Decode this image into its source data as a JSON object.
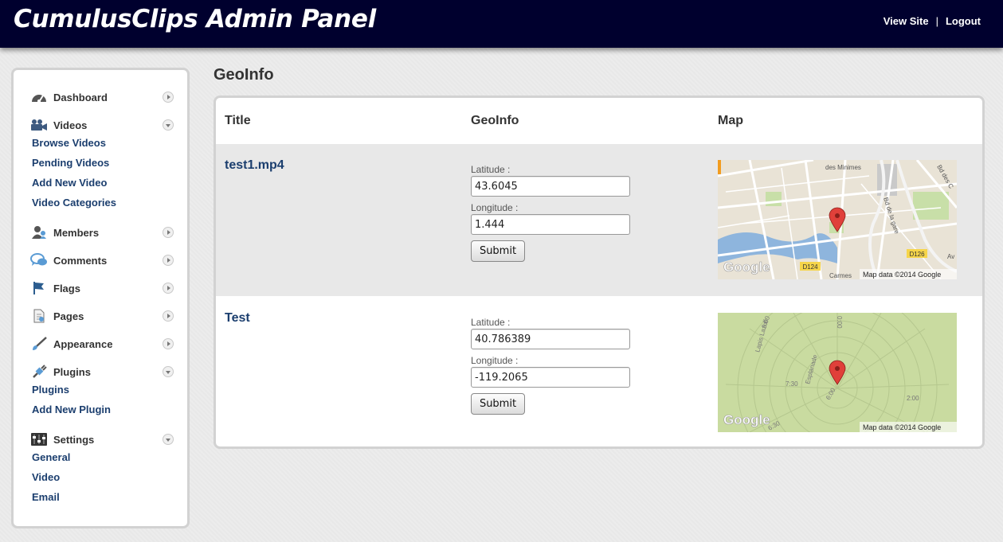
{
  "header": {
    "title": "CumulusClips Admin Panel",
    "links": {
      "view_site": "View Site",
      "separator": "|",
      "logout": "Logout"
    }
  },
  "sidebar": {
    "dashboard": {
      "label": "Dashboard"
    },
    "videos": {
      "label": "Videos",
      "items": [
        "Browse Videos",
        "Pending Videos",
        "Add New Video",
        "Video Categories"
      ]
    },
    "members": {
      "label": "Members"
    },
    "comments": {
      "label": "Comments"
    },
    "flags": {
      "label": "Flags"
    },
    "pages": {
      "label": "Pages"
    },
    "appearance": {
      "label": "Appearance"
    },
    "plugins": {
      "label": "Plugins",
      "items": [
        "Plugins",
        "Add New Plugin"
      ]
    },
    "settings": {
      "label": "Settings",
      "items": [
        "General",
        "Video",
        "Email"
      ]
    }
  },
  "main": {
    "page_title": "GeoInfo",
    "columns": [
      "Title",
      "GeoInfo",
      "Map"
    ],
    "rows": [
      {
        "title": "test1.mp4",
        "latitude_label": "Latitude :",
        "latitude": "43.6045",
        "longitude_label": "Longitude :",
        "longitude": "1.444",
        "submit": "Submit",
        "map": {
          "attribution": "Map data ©2014 Google",
          "logo": "Google",
          "streets": [
            "des Minimes",
            "Bd des C",
            "Bd de la gare",
            "D126",
            "D124",
            "Carmes",
            "Av"
          ]
        }
      },
      {
        "title": "Test",
        "latitude_label": "Latitude :",
        "latitude": "40.786389",
        "longitude_label": "Longitude :",
        "longitude": "-119.2065",
        "submit": "Submit",
        "map": {
          "attribution": "Map data ©2014 Google",
          "logo": "Google",
          "streets": [
            "Lapis Lazuli",
            "9:00",
            "0:00",
            "Esplanade",
            "7:30",
            "6:00",
            "2:00",
            "6:30"
          ]
        }
      }
    ]
  },
  "colors": {
    "header_bg": "#00002e",
    "link": "#1b3e6e",
    "row_alt": "#e8e8e8",
    "map_pin": "#e0403a"
  }
}
